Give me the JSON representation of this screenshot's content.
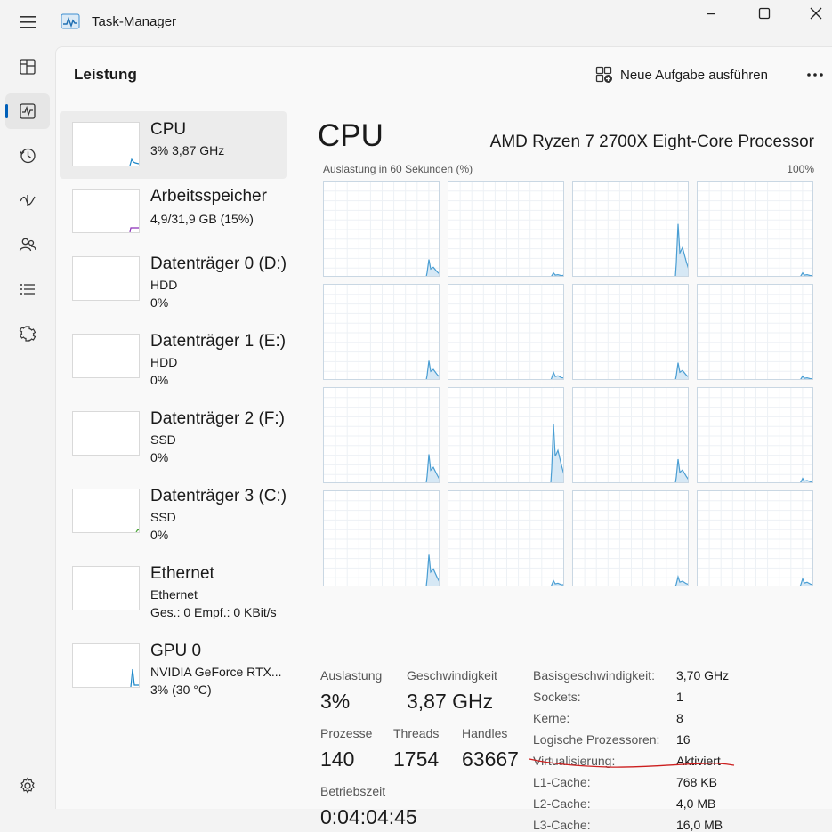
{
  "window": {
    "title": "Task-Manager"
  },
  "rail": {
    "items": [
      {
        "icon": "processes-icon"
      },
      {
        "icon": "performance-icon",
        "active": true
      },
      {
        "icon": "app-history-icon"
      },
      {
        "icon": "startup-apps-icon"
      },
      {
        "icon": "users-icon"
      },
      {
        "icon": "details-icon"
      },
      {
        "icon": "services-icon"
      }
    ],
    "settings_icon": "gear-icon"
  },
  "header": {
    "title": "Leistung",
    "new_task_label": "Neue Aufgabe ausführen",
    "more_icon": "more-horizontal-icon"
  },
  "perf_list": [
    {
      "name": "CPU",
      "lines": [
        "3% 3,87 GHz"
      ],
      "selected": true,
      "color": "#1a86c8"
    },
    {
      "name": "Arbeitsspeicher",
      "lines": [
        "4,9/31,9 GB (15%)"
      ],
      "color": "#8b2fb8"
    },
    {
      "name": "Datenträger 0 (D:)",
      "lines": [
        "HDD",
        "0%"
      ],
      "color": "#4ca63a"
    },
    {
      "name": "Datenträger 1 (E:)",
      "lines": [
        "HDD",
        "0%"
      ],
      "color": "#4ca63a"
    },
    {
      "name": "Datenträger 2 (F:)",
      "lines": [
        "SSD",
        "0%"
      ],
      "color": "#4ca63a"
    },
    {
      "name": "Datenträger 3 (C:)",
      "lines": [
        "SSD",
        "0%"
      ],
      "color": "#4ca63a"
    },
    {
      "name": "Ethernet",
      "lines": [
        "Ethernet",
        "Ges.: 0 Empf.: 0 KBit/s"
      ],
      "color": "#a6672b"
    },
    {
      "name": "GPU 0",
      "lines": [
        "NVIDIA GeForce RTX...",
        "3% (30 °C)"
      ],
      "color": "#1a86c8"
    }
  ],
  "cpu": {
    "title": "CPU",
    "model": "AMD Ryzen 7 2700X Eight-Core Processor",
    "graph_label": "Auslastung in 60 Sekunden (%)",
    "graph_max": "100%",
    "graph_color": "#4a9ed3",
    "graph_fill": "#d6e8f5",
    "core_peaks": [
      18,
      4,
      55,
      4,
      20,
      8,
      18,
      4,
      30,
      62,
      25,
      5,
      33,
      6,
      10,
      8
    ]
  },
  "stats": {
    "utilization_label": "Auslastung",
    "utilization": "3%",
    "speed_label": "Geschwindigkeit",
    "speed": "3,87 GHz",
    "processes_label": "Prozesse",
    "processes": "140",
    "threads_label": "Threads",
    "threads": "1754",
    "handles_label": "Handles",
    "handles": "63667",
    "uptime_label": "Betriebszeit",
    "uptime": "0:04:04:45"
  },
  "specs": [
    {
      "label": "Basisgeschwindigkeit:",
      "value": "3,70 GHz"
    },
    {
      "label": "Sockets:",
      "value": "1"
    },
    {
      "label": "Kerne:",
      "value": "8"
    },
    {
      "label": "Logische Prozessoren:",
      "value": "16"
    },
    {
      "label": "Virtualisierung:",
      "value": "Aktiviert"
    },
    {
      "label": "L1-Cache:",
      "value": "768 KB"
    },
    {
      "label": "L2-Cache:",
      "value": "4,0 MB"
    },
    {
      "label": "L3-Cache:",
      "value": "16,0 MB"
    }
  ],
  "annotation_color": "#cc1f1f"
}
